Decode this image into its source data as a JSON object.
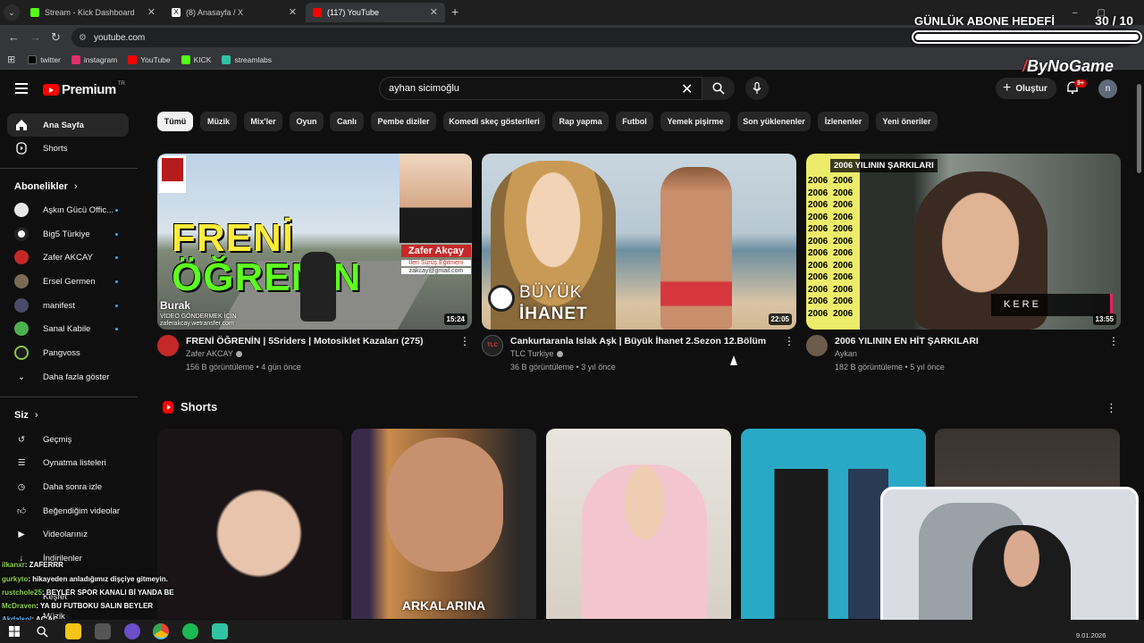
{
  "browser": {
    "tabs": [
      {
        "label": "Stream - Kick Dashboard",
        "favicon_color": "#53fc18"
      },
      {
        "label": "(8) Anasayfa / X",
        "favicon_color": "#000000"
      },
      {
        "label": "(117) YouTube",
        "favicon_color": "#ff0000"
      }
    ],
    "address": "youtube.com",
    "bookmarks": [
      {
        "label": "twitter",
        "icon": "x-icon",
        "color": "#000000"
      },
      {
        "label": "instagram",
        "icon": "instagram-icon",
        "color": "#e1306c"
      },
      {
        "label": "YouTube",
        "icon": "youtube-icon",
        "color": "#ff0000"
      },
      {
        "label": "KICK",
        "icon": "kick-icon",
        "color": "#53fc18"
      },
      {
        "label": "streamlabs",
        "icon": "streamlabs-icon",
        "color": "#31c3a2"
      }
    ]
  },
  "overlay": {
    "goal_title": "GÜNLÜK ABONE HEDEFİ",
    "goal_count": "30  / 10",
    "goal_progress": 1.0,
    "brand": "ByNoGame"
  },
  "youtube": {
    "logo": "Premium",
    "logo_sup": "TR",
    "search_value": "ayhan sicimoğlu",
    "create_label": "Oluştur",
    "notif_badge": "9+",
    "avatar_letter": "n",
    "accent": "#ff0000"
  },
  "sidebar": {
    "top": [
      {
        "label": "Ana Sayfa",
        "icon": "home-icon",
        "active": true
      },
      {
        "label": "Shorts",
        "icon": "shorts-icon",
        "active": false
      }
    ],
    "subs_heading": "Abonelikler",
    "subs": [
      {
        "label": "Aşkın Gücü Offic...",
        "color": "#e8e8e8",
        "live": true
      },
      {
        "label": "Big5 Türkiye",
        "color": "#ffffff",
        "live": true
      },
      {
        "label": "Zafer AKCAY",
        "color": "#c62828",
        "live": true
      },
      {
        "label": "Ersel Germen",
        "color": "#7a6a55",
        "live": true
      },
      {
        "label": "manifest",
        "color": "#4a4a6a",
        "live": true
      },
      {
        "label": "Sanal Kabile",
        "color": "#4caf50",
        "live": true
      },
      {
        "label": "Pangvoss",
        "color": "#1b1b1b",
        "live": false
      }
    ],
    "show_more": "Daha fazla göster",
    "you_heading": "Siz",
    "you": [
      {
        "label": "Geçmiş",
        "icon": "history-icon"
      },
      {
        "label": "Oynatma listeleri",
        "icon": "playlist-icon"
      },
      {
        "label": "Daha sonra izle",
        "icon": "clock-icon"
      },
      {
        "label": "Beğendiğim videolar",
        "icon": "thumbs-up-icon"
      },
      {
        "label": "Videolarınız",
        "icon": "your-videos-icon"
      },
      {
        "label": "İndirilenler",
        "icon": "download-icon"
      },
      {
        "label": "Keşfet",
        "icon": "explore-icon"
      },
      {
        "label": "Müzik",
        "icon": "music-icon"
      }
    ]
  },
  "chips": [
    "Tümü",
    "Müzik",
    "Mix'ler",
    "Oyun",
    "Canlı",
    "Pembe diziler",
    "Komedi skeç gösterileri",
    "Rap yapma",
    "Futbol",
    "Yemek pişirme",
    "Son yüklenenler",
    "İzlenenler",
    "Yeni öneriler"
  ],
  "videos": [
    {
      "title": "FRENİ ÖĞRENİN | 5Sriders | Motosiklet Kazaları (275)",
      "channel": "Zafer AKCAY",
      "stats": "156 B görüntüleme • 4 gün önce",
      "duration": "15:24",
      "thumb_text1": "FRENİ",
      "thumb_text2": "ÖĞRENİN",
      "thumb_name": "Zafer Akçay",
      "thumb_sub": "İleri Sürüş Eğitmeni",
      "thumb_mail": "zakcay@gmail.com",
      "thumb_corner": "Burak",
      "thumb_corner2": "VİDEO GÖNDERMEK İÇİN",
      "thumb_corner3": "zaferakcay.wetransfer.com"
    },
    {
      "title": "Cankurtaranla Islak Aşk | Büyük İhanet 2.Sezon 12.Bölüm",
      "channel": "TLC Turkiye",
      "stats": "36 B görüntüleme • 3 yıl önce",
      "duration": "22:05",
      "thumb_text1": "BÜYÜK",
      "thumb_text2": "İHANET"
    },
    {
      "title": "2006 YILININ EN HİT ŞARKILARI",
      "channel": "Aykan",
      "stats": "182 B görüntüleme • 5 yıl önce",
      "duration": "13:55",
      "thumb_banner": "2006 YILININ ŞARKILARI",
      "thumb_year": "2006",
      "thumb_caption": "KERE"
    }
  ],
  "shorts": {
    "heading": "Shorts",
    "items": [
      {
        "caption": ""
      },
      {
        "caption": "ARKALARINA"
      },
      {
        "caption": ""
      },
      {
        "caption": ""
      },
      {
        "caption": ""
      }
    ]
  },
  "chat": [
    {
      "user": "ilkanxr",
      "msg": ": ZAFERRR"
    },
    {
      "user": "gurkyto",
      "msg": ": hikayeden anladığımız dişçiye gitmeyin."
    },
    {
      "user": "rustchole25",
      "msg": ": BEYLER SPOR KANALI Bİ YANDA BE"
    },
    {
      "user": "McDraven",
      "msg": ": YA BU FUTBOKU SALIN BEYLER"
    },
    {
      "user": "Akdalsol",
      "msg": ": AÇ AÇ"
    }
  ],
  "taskbar": {
    "date": "9.01.2026",
    "time": ""
  }
}
